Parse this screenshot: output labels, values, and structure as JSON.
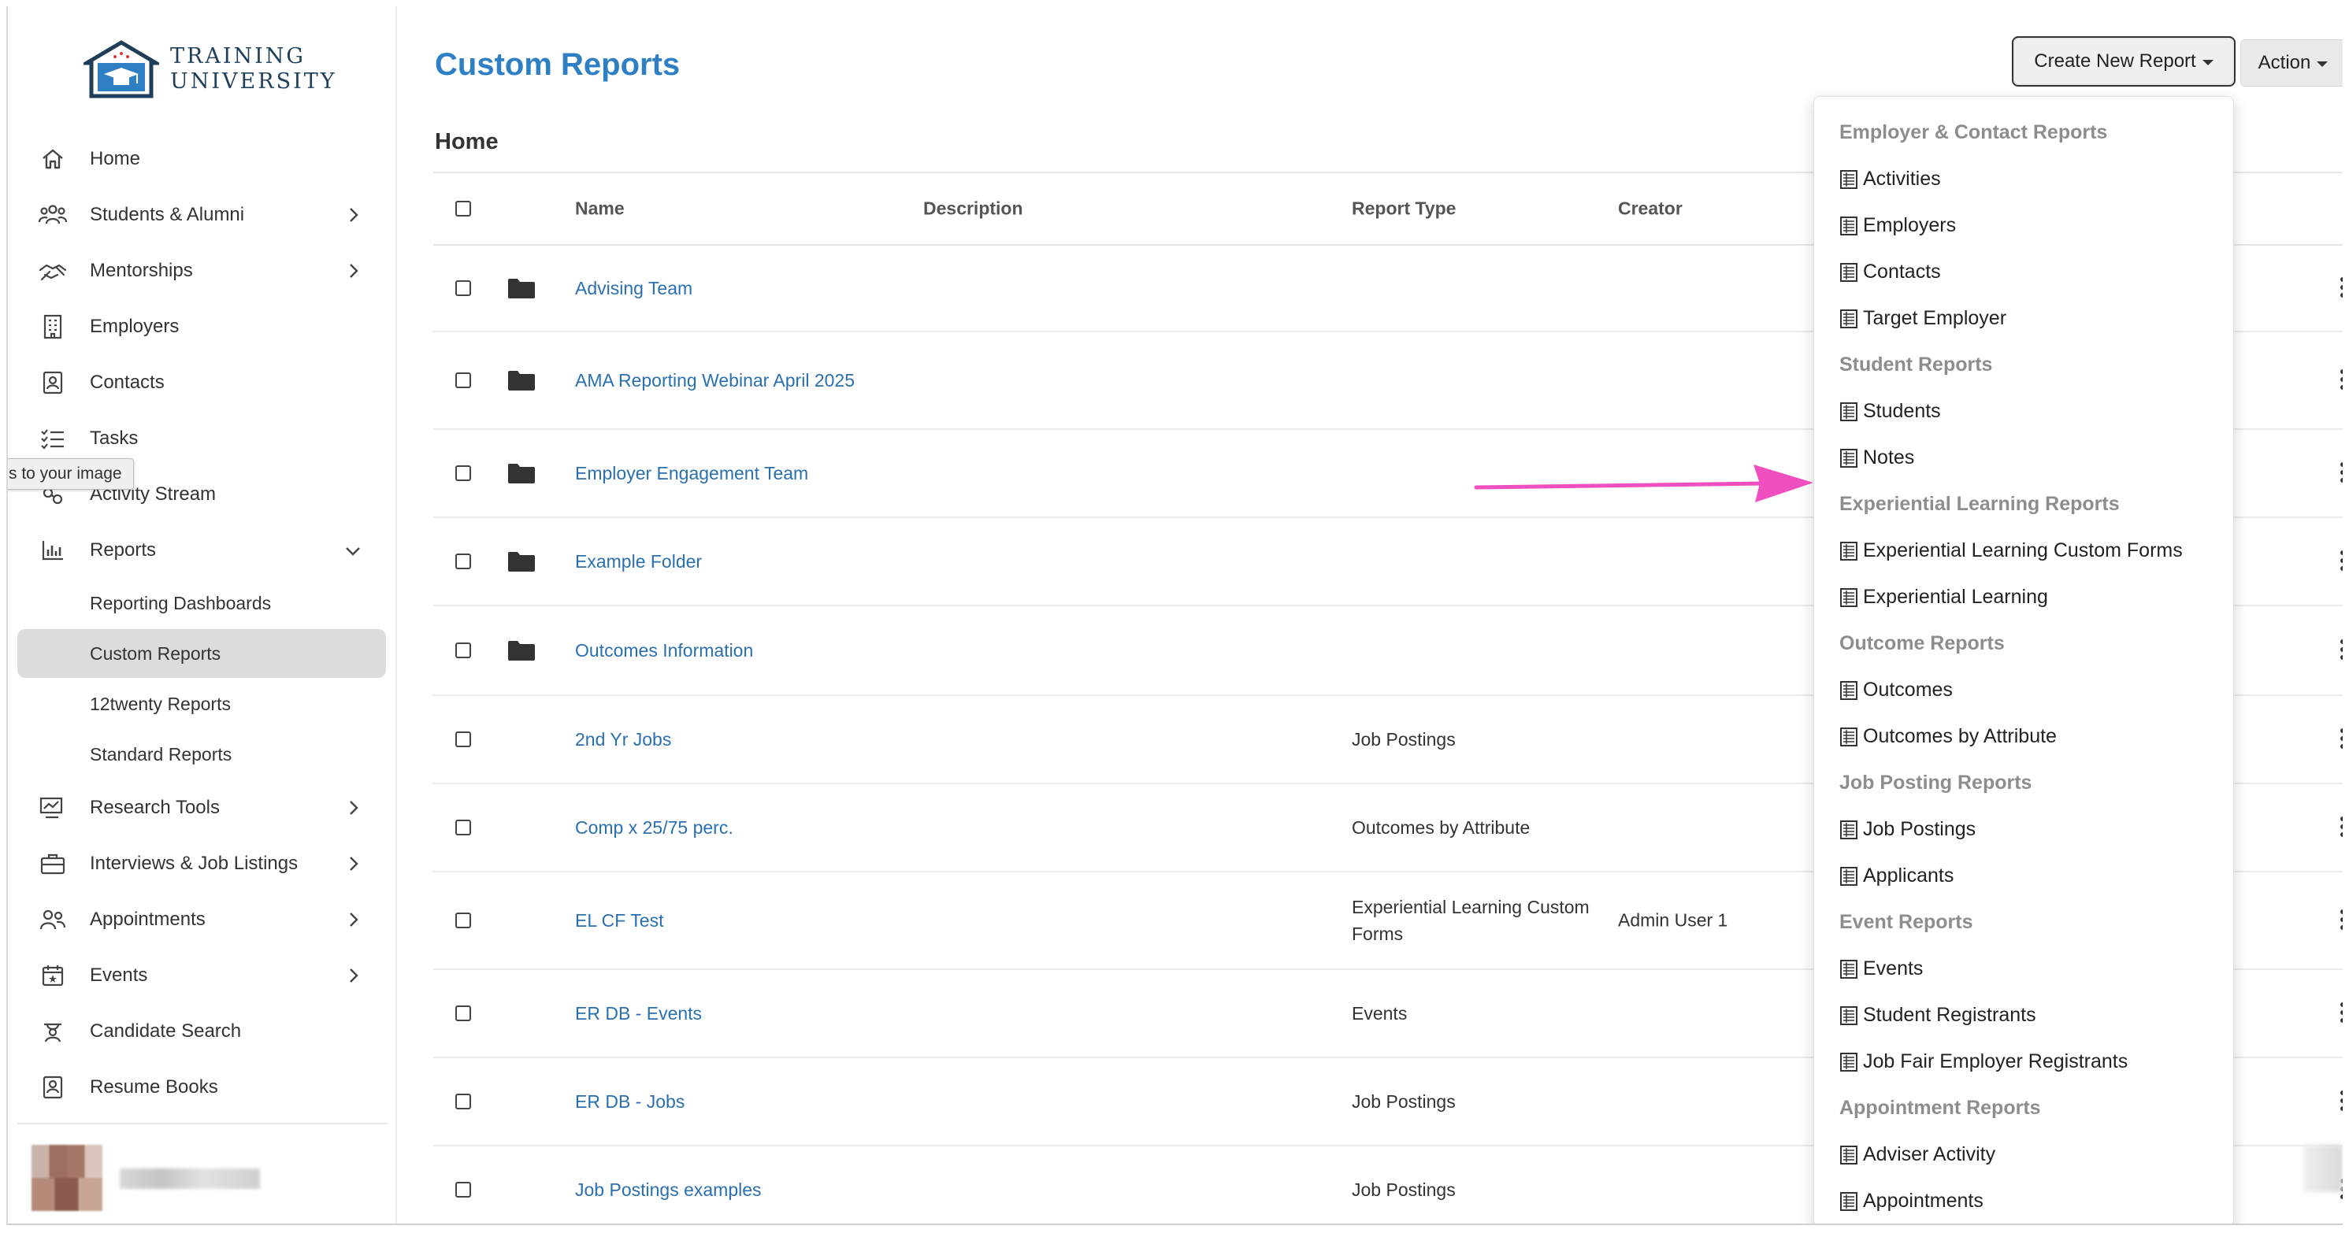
{
  "brand": {
    "line1": "TRAINING",
    "line2": "UNIVERSITY"
  },
  "sidebar": {
    "items": [
      {
        "label": "Home",
        "icon": "home-icon"
      },
      {
        "label": "Students & Alumni",
        "icon": "users-icon",
        "chevron": "right"
      },
      {
        "label": "Mentorships",
        "icon": "handshake-icon",
        "chevron": "right"
      },
      {
        "label": "Employers",
        "icon": "building-icon"
      },
      {
        "label": "Contacts",
        "icon": "contact-card-icon"
      },
      {
        "label": "Tasks",
        "icon": "checklist-icon"
      },
      {
        "label": "Activity Stream",
        "icon": "activity-icon"
      },
      {
        "label": "Reports",
        "icon": "bar-chart-icon",
        "chevron": "down"
      }
    ],
    "report_subitems": [
      "Reporting Dashboards",
      "Custom Reports",
      "12twenty Reports",
      "Standard Reports"
    ],
    "items_after": [
      {
        "label": "Research Tools",
        "icon": "research-icon",
        "chevron": "right"
      },
      {
        "label": "Interviews & Job Listings",
        "icon": "briefcase-icon",
        "chevron": "right"
      },
      {
        "label": "Appointments",
        "icon": "people-icon",
        "chevron": "right"
      },
      {
        "label": "Events",
        "icon": "calendar-icon",
        "chevron": "right"
      },
      {
        "label": "Candidate Search",
        "icon": "candidate-icon"
      },
      {
        "label": "Resume Books",
        "icon": "book-icon"
      }
    ],
    "tooltip": "s to your image"
  },
  "header": {
    "title": "Custom Reports",
    "create_button": "Create New Report",
    "action_button": "Action"
  },
  "section": {
    "title": "Home"
  },
  "table": {
    "columns": {
      "name": "Name",
      "description": "Description",
      "report_type": "Report Type",
      "creator": "Creator"
    },
    "rows": [
      {
        "name": "Advising Team",
        "folder": true,
        "type": "",
        "creator": ""
      },
      {
        "name": "AMA Reporting Webinar April 2025",
        "folder": true,
        "type": "",
        "creator": ""
      },
      {
        "name": "Employer Engagement Team",
        "folder": true,
        "type": "",
        "creator": ""
      },
      {
        "name": "Example Folder",
        "folder": true,
        "type": "",
        "creator": ""
      },
      {
        "name": "Outcomes Information",
        "folder": true,
        "type": "",
        "creator": ""
      },
      {
        "name": "2nd Yr Jobs",
        "folder": false,
        "type": "Job Postings",
        "creator": ""
      },
      {
        "name": "Comp x 25/75 perc.",
        "folder": false,
        "type": "Outcomes by Attribute",
        "creator": ""
      },
      {
        "name": "EL CF Test",
        "folder": false,
        "type": "Experiential Learning Custom Forms",
        "creator": "Admin User 1"
      },
      {
        "name": "ER DB - Events",
        "folder": false,
        "type": "Events",
        "creator": ""
      },
      {
        "name": "ER DB - Jobs",
        "folder": false,
        "type": "Job Postings",
        "creator": ""
      },
      {
        "name": "Job Postings examples",
        "folder": false,
        "type": "Job Postings",
        "creator": ""
      }
    ]
  },
  "dropdown": [
    {
      "header": "Employer & Contact Reports",
      "items": [
        "Activities",
        "Employers",
        "Contacts",
        "Target Employer"
      ]
    },
    {
      "header": "Student Reports",
      "items": [
        "Students",
        "Notes"
      ]
    },
    {
      "header": "Experiential Learning Reports",
      "items": [
        "Experiential Learning Custom Forms",
        "Experiential Learning"
      ]
    },
    {
      "header": "Outcome Reports",
      "items": [
        "Outcomes",
        "Outcomes by Attribute"
      ]
    },
    {
      "header": "Job Posting Reports",
      "items": [
        "Job Postings",
        "Applicants"
      ]
    },
    {
      "header": "Event Reports",
      "items": [
        "Events",
        "Student Registrants",
        "Job Fair Employer Registrants"
      ]
    },
    {
      "header": "Appointment Reports",
      "items": [
        "Adviser Activity",
        "Appointments"
      ]
    }
  ],
  "colors": {
    "accent": "#2f7fc4",
    "link": "#2a6fb0",
    "arrow": "#f04fbf",
    "active_bg": "#dcdcdc"
  }
}
